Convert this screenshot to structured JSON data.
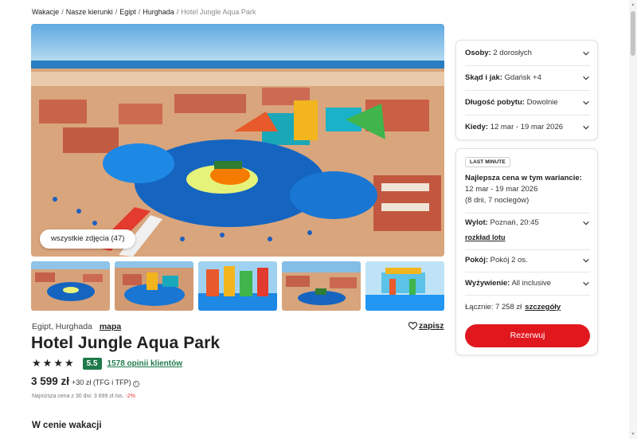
{
  "breadcrumb": {
    "items": [
      "Wakacje",
      "Nasze kierunki",
      "Egipt",
      "Hurghada"
    ],
    "current": "Hotel Jungle Aqua Park",
    "separator": "/"
  },
  "gallery": {
    "all_photos_label": "wszystkie zdjęcia (47)"
  },
  "hotel": {
    "location": "Egipt, Hurghada",
    "map_label": "mapa",
    "save_label": "zapisz",
    "name": "Hotel Jungle Aqua Park",
    "stars": 4,
    "score": "5.5",
    "reviews_label": "1578 opinii klientów",
    "price": "3 599 zł",
    "price_extra": "+30 zł (TFG i TFP)",
    "lowest_price_prefix": "Najniższa cena z 30 dni: 3 699 zł /os.",
    "lowest_price_discount": "-2%"
  },
  "section": {
    "title": "W cenie wakacji"
  },
  "filters": [
    {
      "label": "Osoby:",
      "value": "2 dorosłych"
    },
    {
      "label": "Skąd i jak:",
      "value": "Gdańsk +4"
    },
    {
      "label": "Długość pobytu:",
      "value": "Dowolnie"
    },
    {
      "label": "Kiedy:",
      "value": "12 mar - 19 mar 2026"
    }
  ],
  "offer": {
    "badge": "LAST MINUTE",
    "best_title": "Najlepsza cena w tym wariancie:",
    "dates": "12 mar - 19 mar 2026",
    "nights": "(8 dni, 7 noclegów)",
    "flight_label": "Wylot:",
    "flight_value": "Poznań, 20:45",
    "schedule_label": "rozkład lotu",
    "room_label": "Pokój:",
    "room_value": "Pokój 2 os.",
    "board_label": "Wyżywienie:",
    "board_value": "All inclusive",
    "total_label": "Łącznie: 7 258 zł",
    "details_label": "szczegóły",
    "book_label": "Rezerwuj"
  },
  "icons": {
    "chevron": "chevron-down-icon",
    "heart": "heart-icon",
    "star": "star-icon",
    "info": "info-icon"
  },
  "colors": {
    "accent_red": "#e1171e",
    "score_green": "#1f7a4b",
    "discount_red": "#e53935",
    "pool_blue": "#1565c0"
  }
}
